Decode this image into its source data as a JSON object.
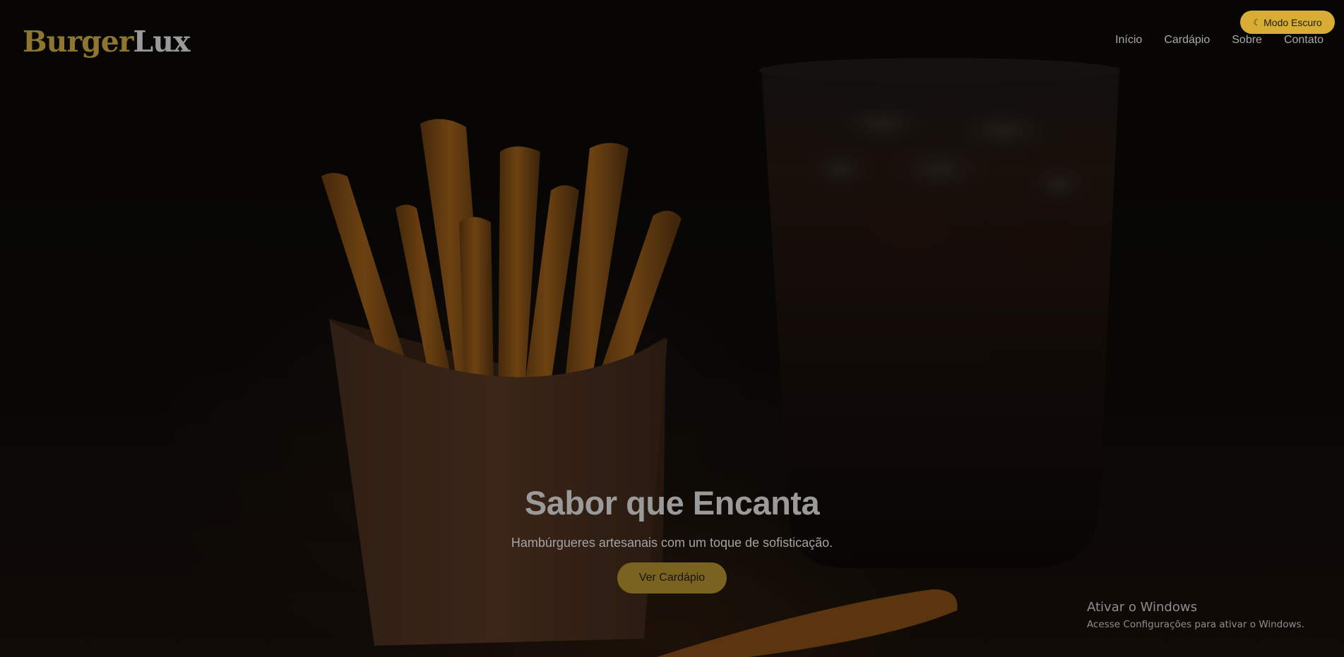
{
  "header": {
    "logo_part1": "Burger",
    "logo_part2": "Lux",
    "theme_toggle": {
      "icon": "crescent-moon-icon",
      "label": "Modo Escuro"
    },
    "nav": [
      {
        "label": "Início"
      },
      {
        "label": "Cardápio"
      },
      {
        "label": "Sobre"
      },
      {
        "label": "Contato"
      }
    ]
  },
  "hero": {
    "title": "Sabor que Encanta",
    "subtitle": "Hambúrgueres artesanais com um toque de sofisticação.",
    "cta_label": "Ver Cardápio",
    "background": "french fries in a paper box next to a glass of soda, dimmed"
  },
  "watermark": {
    "title": "Ativar o Windows",
    "subtitle": "Acesse Configurações para ativar o Windows."
  },
  "colors": {
    "brand_gold": "#d7ad33",
    "logo_gold": "#8f7630",
    "cta_gold": "#7a6320",
    "background": "#0a0908"
  }
}
